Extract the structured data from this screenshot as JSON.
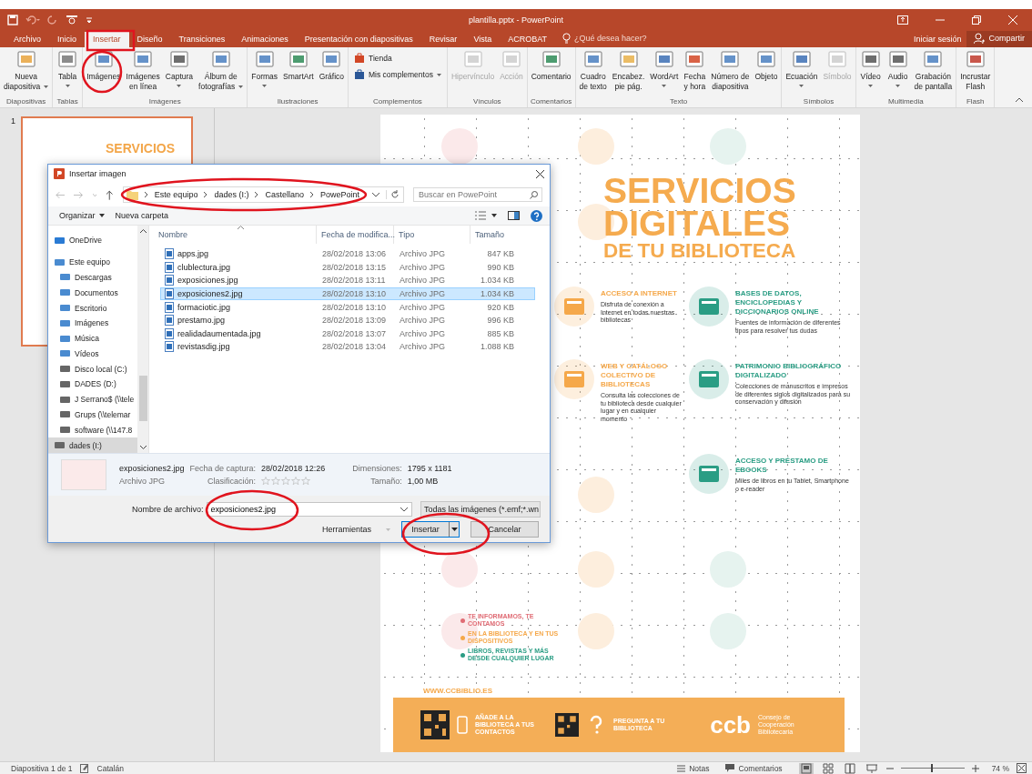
{
  "window": {
    "title": "plantilla.pptx - PowerPoint"
  },
  "tabs": [
    {
      "label": "Archivo",
      "selected": false
    },
    {
      "label": "Inicio",
      "selected": false
    },
    {
      "label": "Insertar",
      "selected": true
    },
    {
      "label": "Diseño",
      "selected": false
    },
    {
      "label": "Transiciones",
      "selected": false
    },
    {
      "label": "Animaciones",
      "selected": false
    },
    {
      "label": "Presentación con diapositivas",
      "selected": false
    },
    {
      "label": "Revisar",
      "selected": false
    },
    {
      "label": "Vista",
      "selected": false
    },
    {
      "label": "ACROBAT",
      "selected": false
    }
  ],
  "tell_me": {
    "placeholder": "¿Qué desea hacer?"
  },
  "account": {
    "sign_in": "Iniciar sesión",
    "share": "Compartir"
  },
  "ribbon": {
    "groups": [
      {
        "label": "Diapositivas",
        "commands": [
          {
            "kind": "large",
            "lines": [
              "Nueva",
              "diapositiva"
            ],
            "dropdown": true,
            "disabled": false
          }
        ]
      },
      {
        "label": "Tablas",
        "commands": [
          {
            "kind": "large",
            "lines": [
              "Tabla"
            ],
            "dropdown": true,
            "disabled": false
          }
        ]
      },
      {
        "label": "Imágenes",
        "commands": [
          {
            "kind": "large",
            "lines": [
              "Imágenes"
            ],
            "dropdown": false,
            "disabled": false
          },
          {
            "kind": "large",
            "lines": [
              "Imágenes",
              "en línea"
            ],
            "dropdown": false,
            "disabled": false
          },
          {
            "kind": "large",
            "lines": [
              "Captura"
            ],
            "dropdown": true,
            "disabled": false
          },
          {
            "kind": "large",
            "lines": [
              "Álbum de",
              "fotografías"
            ],
            "dropdown": true,
            "disabled": false
          }
        ]
      },
      {
        "label": "Ilustraciones",
        "commands": [
          {
            "kind": "large",
            "lines": [
              "Formas"
            ],
            "dropdown": true,
            "disabled": false
          },
          {
            "kind": "large",
            "lines": [
              "SmartArt"
            ],
            "dropdown": false,
            "disabled": false
          },
          {
            "kind": "large",
            "lines": [
              "Gráfico"
            ],
            "dropdown": false,
            "disabled": false
          }
        ]
      },
      {
        "label": "Complementos",
        "commands": [
          {
            "kind": "small",
            "lines": [
              "Tienda"
            ],
            "dropdown": false,
            "disabled": false
          },
          {
            "kind": "small",
            "lines": [
              "Mis complementos"
            ],
            "dropdown": true,
            "disabled": false
          }
        ]
      },
      {
        "label": "Vínculos",
        "commands": [
          {
            "kind": "large",
            "lines": [
              "Hipervínculo"
            ],
            "dropdown": false,
            "disabled": true
          },
          {
            "kind": "large",
            "lines": [
              "Acción"
            ],
            "dropdown": false,
            "disabled": true
          }
        ]
      },
      {
        "label": "Comentarios",
        "commands": [
          {
            "kind": "large",
            "lines": [
              "Comentario"
            ],
            "dropdown": false,
            "disabled": false
          }
        ]
      },
      {
        "label": "Texto",
        "commands": [
          {
            "kind": "large",
            "lines": [
              "Cuadro",
              "de texto"
            ],
            "dropdown": false,
            "disabled": false
          },
          {
            "kind": "large",
            "lines": [
              "Encabez.",
              "pie pág."
            ],
            "dropdown": false,
            "disabled": false
          },
          {
            "kind": "large",
            "lines": [
              "WordArt"
            ],
            "dropdown": true,
            "disabled": false
          },
          {
            "kind": "large",
            "lines": [
              "Fecha",
              "y hora"
            ],
            "dropdown": false,
            "disabled": false
          },
          {
            "kind": "large",
            "lines": [
              "Número de",
              "diapositiva"
            ],
            "dropdown": false,
            "disabled": false
          },
          {
            "kind": "large",
            "lines": [
              "Objeto"
            ],
            "dropdown": false,
            "disabled": false
          }
        ]
      },
      {
        "label": "Símbolos",
        "commands": [
          {
            "kind": "large",
            "lines": [
              "Ecuación"
            ],
            "dropdown": true,
            "disabled": false
          },
          {
            "kind": "large",
            "lines": [
              "Símbolo"
            ],
            "dropdown": false,
            "disabled": true
          }
        ]
      },
      {
        "label": "Multimedia",
        "commands": [
          {
            "kind": "large",
            "lines": [
              "Vídeo"
            ],
            "dropdown": true,
            "disabled": false
          },
          {
            "kind": "large",
            "lines": [
              "Audio"
            ],
            "dropdown": true,
            "disabled": false
          },
          {
            "kind": "large",
            "lines": [
              "Grabación",
              "de pantalla"
            ],
            "dropdown": false,
            "disabled": false
          }
        ]
      },
      {
        "label": "Flash",
        "commands": [
          {
            "kind": "large",
            "lines": [
              "Incrustar",
              "Flash"
            ],
            "dropdown": false,
            "disabled": false
          }
        ]
      }
    ]
  },
  "thumbnails": [
    {
      "number": "1",
      "title": "SERVICIOS",
      "selected": true
    }
  ],
  "slide": {
    "title_lines": [
      "SERVICIOS",
      "DIGITALES",
      "DE TU BIBLIOTECA"
    ],
    "features": [
      {
        "title": "ACCESO A INTERNET",
        "text": "Disfruta de conexión a Internet en todas nuestras bibliotecas",
        "color": "#f5a84a"
      },
      {
        "title": "BASES DE DATOS, ENCICLOPEDIAS Y DICCIONARIOS ONLINE",
        "text": "Fuentes de información de diferentes tipos para resolver tus dudas",
        "color": "#2a9d84"
      },
      {
        "title": "WEB Y CATÁLOGO COLECTIVO DE BIBLIOTECAS",
        "text": "Consulta las colecciones de tu biblioteca desde cualquier lugar y en cualquier momento",
        "color": "#f5a84a"
      },
      {
        "title": "PATRIMONIO BIBLIOGRÁFICO DIGITALIZADO",
        "text": "Colecciones de manuscritos e impresos de diferentes siglos digitalizados para su conservación y difusión",
        "color": "#2a9d84"
      },
      {
        "title": "ACCESO Y PRÉSTAMO DE EBOOKS",
        "text": "Miles de libros en tu Tablet, Smartphone o e-reader",
        "color": "#2a9d84"
      }
    ],
    "legend": [
      {
        "text": "TE INFORMAMOS, TE CONTAMOS",
        "color": "#e06c75"
      },
      {
        "text": "EN LA BIBLIOTECA Y EN TUS DISPOSITIVOS",
        "color": "#f5a84a"
      },
      {
        "text": "LIBROS, REVISTAS Y MÁS DESDE CUALQUIER LUGAR",
        "color": "#2a9d84"
      }
    ],
    "website": "WWW.CCBIBLIO.ES",
    "footer": {
      "contacts": "AÑADE A LA BIBLIOTECA A TUS CONTACTOS",
      "ask": "PREGUNTA A TU BIBLIOTECA",
      "logo": "ccb",
      "org": "Consejo de Cooperación Bibliotecaria"
    }
  },
  "dialog": {
    "title": "Insertar imagen",
    "breadcrumb": [
      "Este equipo",
      "dades (I:)",
      "Castellano",
      "PowePoint"
    ],
    "search": {
      "placeholder": "Buscar en PowePoint"
    },
    "commands": [
      "Organizar",
      "Nueva carpeta"
    ],
    "nav": [
      {
        "label": "OneDrive",
        "selected": false
      },
      {
        "label": "Este equipo",
        "selected": false
      },
      {
        "label": "Descargas",
        "selected": false
      },
      {
        "label": "Documentos",
        "selected": false
      },
      {
        "label": "Escritorio",
        "selected": false
      },
      {
        "label": "Imágenes",
        "selected": false
      },
      {
        "label": "Música",
        "selected": false
      },
      {
        "label": "Vídeos",
        "selected": false
      },
      {
        "label": "Disco local (C:)",
        "selected": false
      },
      {
        "label": "DADES (D:)",
        "selected": false
      },
      {
        "label": "J Serrano$ (\\\\tele",
        "selected": false
      },
      {
        "label": "Grups (\\\\telemar",
        "selected": false
      },
      {
        "label": "software (\\\\147.8",
        "selected": false
      },
      {
        "label": "dades (I:)",
        "selected": true
      }
    ],
    "columns": [
      "Nombre",
      "Fecha de modifica...",
      "Tipo",
      "Tamaño"
    ],
    "files": [
      {
        "name": "apps.jpg",
        "date": "28/02/2018 13:06",
        "type": "Archivo JPG",
        "size": "847 KB",
        "selected": false
      },
      {
        "name": "clublectura.jpg",
        "date": "28/02/2018 13:15",
        "type": "Archivo JPG",
        "size": "990 KB",
        "selected": false
      },
      {
        "name": "exposiciones.jpg",
        "date": "28/02/2018 13:11",
        "type": "Archivo JPG",
        "size": "1.034 KB",
        "selected": false
      },
      {
        "name": "exposiciones2.jpg",
        "date": "28/02/2018 13:10",
        "type": "Archivo JPG",
        "size": "1.034 KB",
        "selected": true
      },
      {
        "name": "formaciotic.jpg",
        "date": "28/02/2018 13:10",
        "type": "Archivo JPG",
        "size": "920 KB",
        "selected": false
      },
      {
        "name": "prestamo.jpg",
        "date": "28/02/2018 13:09",
        "type": "Archivo JPG",
        "size": "996 KB",
        "selected": false
      },
      {
        "name": "realidadaumentada.jpg",
        "date": "28/02/2018 13:07",
        "type": "Archivo JPG",
        "size": "885 KB",
        "selected": false
      },
      {
        "name": "revistasdig.jpg",
        "date": "28/02/2018 13:04",
        "type": "Archivo JPG",
        "size": "1.088 KB",
        "selected": false
      }
    ],
    "details": {
      "name": "exposiciones2.jpg",
      "type": "Archivo JPG",
      "date_label": "Fecha de captura:",
      "date": "28/02/2018 12:26",
      "rating_label": "Clasificación:",
      "stars": 0,
      "dimensions_label": "Dimensiones:",
      "dimensions": "1795 x 1181",
      "size_label": "Tamaño:",
      "size": "1,00 MB"
    },
    "filename_label": "Nombre de archivo:",
    "filename": "exposiciones2.jpg",
    "filetype": "Todas las imágenes (*.emf;*.wn",
    "buttons": {
      "tools": "Herramientas",
      "insert": "Insertar",
      "cancel": "Cancelar"
    }
  },
  "status_bar": {
    "slide": "Diapositiva 1 de 1",
    "language": "Catalán",
    "notes": "Notas",
    "comments": "Comentarios",
    "zoom": "74 %",
    "level": 0.47
  }
}
